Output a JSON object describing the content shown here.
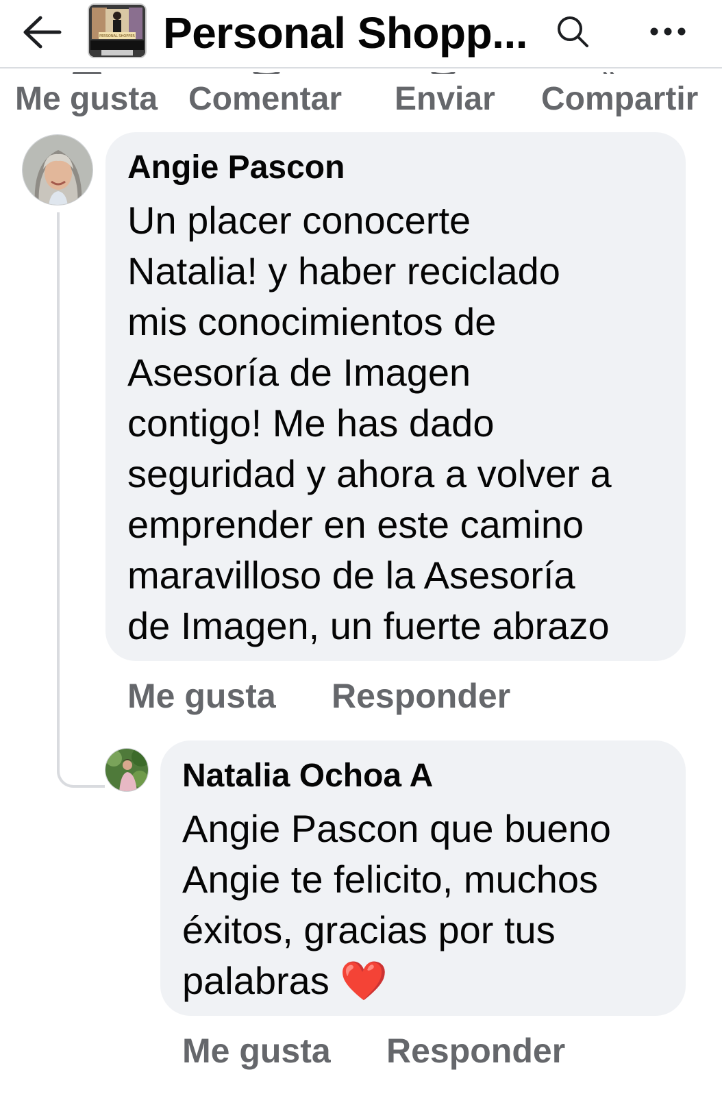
{
  "header": {
    "title": "Personal Shopp...",
    "back_icon": "arrow-left-icon",
    "search_icon": "search-icon",
    "more_icon": "more-horizontal-icon",
    "avatar_text": "PERSONAL SHOPPER"
  },
  "post_actions": {
    "like": "Me gusta",
    "comment": "Comentar",
    "send": "Enviar",
    "share": "Compartir"
  },
  "comments": [
    {
      "author": "Angie Pascon",
      "lines": [
        "Un placer conocerte",
        "Natalia! y haber reciclado",
        "mis conocimientos de",
        "Asesoría de Imagen",
        "contigo! Me has dado",
        "seguridad y ahora a volver a",
        "emprender en este camino",
        "maravilloso de la Asesoría",
        "de Imagen, un fuerte abrazo"
      ],
      "like_label": "Me gusta",
      "reply_label": "Responder"
    },
    {
      "author": "Natalia Ochoa A",
      "lines": [
        "Angie Pascon que bueno",
        "Angie te felicito, muchos",
        "éxitos, gracias por tus",
        "palabras"
      ],
      "emoji": "❤️",
      "like_label": "Me gusta",
      "reply_label": "Responder"
    }
  ],
  "colors": {
    "bubble": "#f0f2f5",
    "secondary_text": "#65676b",
    "primary_text": "#050505",
    "heart": "#e81b25"
  }
}
